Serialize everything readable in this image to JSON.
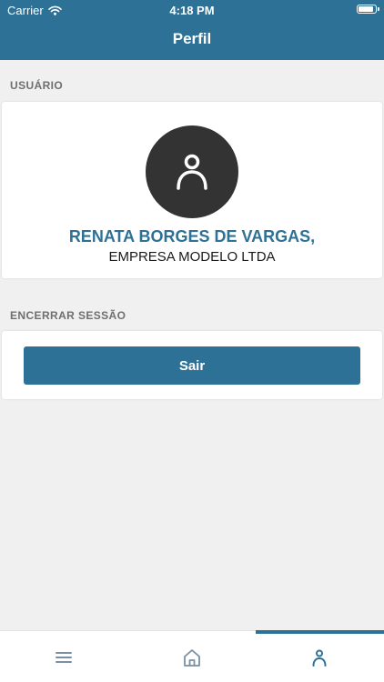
{
  "status_bar": {
    "carrier": "Carrier",
    "time": "4:18 PM"
  },
  "header": {
    "title": "Perfil"
  },
  "user_section": {
    "label": "USUÁRIO",
    "name": "RENATA BORGES DE VARGAS,",
    "company": "EMPRESA MODELO LTDA",
    "avatar_icon": "person-icon"
  },
  "session_section": {
    "label": "ENCERRAR SESSÃO",
    "logout_label": "Sair"
  },
  "tab_bar": {
    "tabs": [
      {
        "icon": "menu-icon",
        "active": false
      },
      {
        "icon": "home-icon",
        "active": false
      },
      {
        "icon": "profile-icon",
        "active": true
      }
    ]
  },
  "colors": {
    "primary": "#2e7196",
    "avatar_background": "#333333",
    "background": "#f0f0f0",
    "inactive_icon": "#7a8fa3"
  }
}
